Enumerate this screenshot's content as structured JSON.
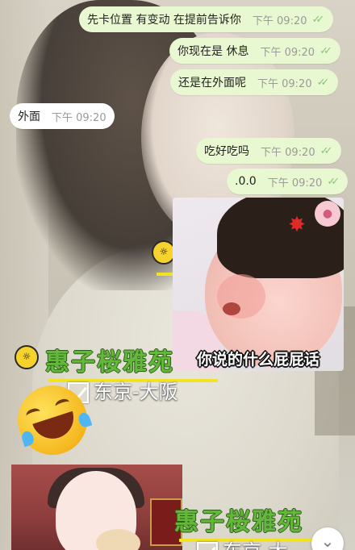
{
  "messages": [
    {
      "text": "先卡位置 有变动 在提前告诉你",
      "time": "下午 09:20",
      "dir": "out"
    },
    {
      "text": "你现在是 休息",
      "time": "下午 09:20",
      "dir": "out"
    },
    {
      "text": "还是在外面呢",
      "time": "下午 09:20",
      "dir": "out"
    },
    {
      "text": "外面",
      "time": "下午 09:20",
      "dir": "in"
    },
    {
      "text": "吃好吃吗",
      "time": "下午 09:20",
      "dir": "out"
    },
    {
      "text": ".0.0",
      "time": "下午 09:20",
      "dir": "out"
    }
  ],
  "read_tick": "✓✓",
  "sticker": {
    "caption": "你说的什么屁屁话",
    "badge_icon": "angry-symbol-icon",
    "pig_icon": "pig-icon"
  },
  "wallpaper": {
    "brand_title_1": "惠子桜雅苑",
    "route_1": "东京-大阪",
    "brand_title_2": "惠子桜雅苑",
    "route_2": "东京-大"
  },
  "colors": {
    "outgoing": "#e8f8d0",
    "incoming": "#ffffff",
    "time": "#9a9a9a",
    "tick": "#8cc37c",
    "brand_green": "#63b83a"
  },
  "scroll_icon": "chevron-down-icon"
}
